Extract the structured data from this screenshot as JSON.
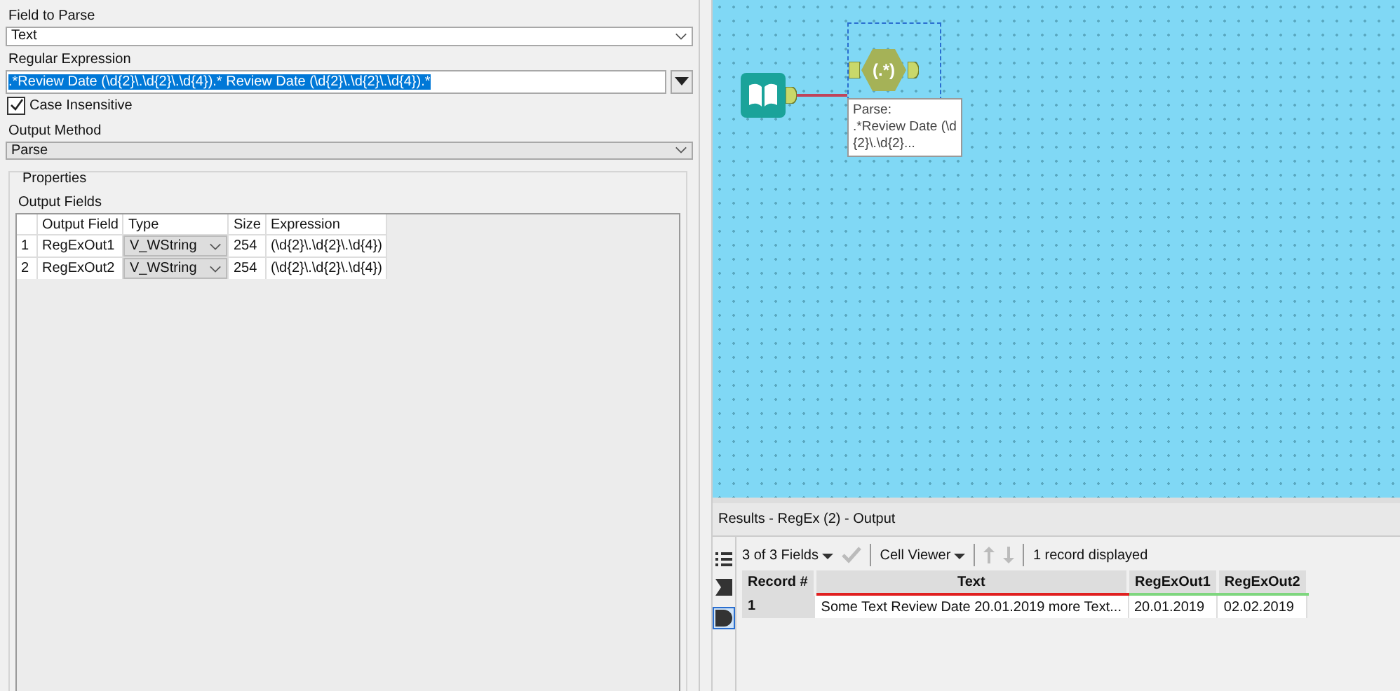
{
  "config": {
    "field_to_parse": {
      "label": "Field to Parse",
      "value": "Text"
    },
    "regular_expression": {
      "label": "Regular Expression",
      "value": ".*Review Date (\\d{2}\\.\\d{2}\\.\\d{4}).* Review Date (\\d{2}\\.\\d{2}\\.\\d{4}).*",
      "selected": true
    },
    "case_insensitive": {
      "label": "Case Insensitive",
      "checked": true
    },
    "output_method": {
      "label": "Output Method",
      "value": "Parse"
    },
    "properties": {
      "title": "Properties",
      "subtitle": "Output Fields",
      "columns": [
        "Output Field",
        "Type",
        "Size",
        "Expression"
      ],
      "rows": [
        {
          "index": "1",
          "field": "RegExOut1",
          "type": "V_WString",
          "size": "254",
          "expression": "(\\d{2}\\.\\d{2}\\.\\d{4})"
        },
        {
          "index": "2",
          "field": "RegExOut2",
          "type": "V_WString",
          "size": "254",
          "expression": "(\\d{2}\\.\\d{2}\\.\\d{4})"
        }
      ]
    }
  },
  "canvas": {
    "tool": {
      "symbol": "(.*)",
      "selected": true
    },
    "annotation": [
      "Parse:",
      ".*Review Date (\\d",
      "{2}\\.\\d{2}..."
    ]
  },
  "results": {
    "title": "Results - RegEx (2) - Output",
    "fields_selector": "3 of 3 Fields",
    "viewer": "Cell Viewer",
    "status": "1 record displayed",
    "columns": [
      {
        "name": "Record #",
        "kind": "index"
      },
      {
        "name": "Text",
        "kind": "warn"
      },
      {
        "name": "RegExOut1",
        "kind": "ok"
      },
      {
        "name": "RegExOut2",
        "kind": "ok"
      }
    ],
    "rows": [
      [
        "1",
        "Some Text Review Date 20.01.2019 more Text...",
        "20.01.2019",
        "02.02.2019"
      ]
    ]
  }
}
